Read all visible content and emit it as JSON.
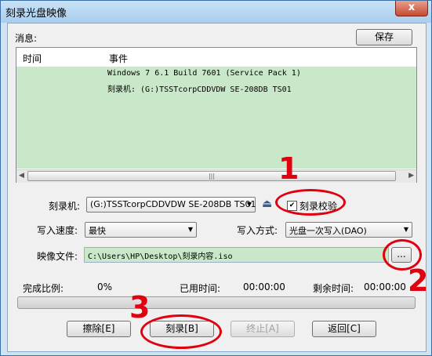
{
  "window": {
    "title": "刻录光盘映像",
    "close_label": "x"
  },
  "messages": {
    "label": "消息:",
    "save_label": "保存",
    "columns": [
      "时间",
      "事件"
    ],
    "rows": [
      "Windows 7 6.1 Build 7601 (Service Pack 1)",
      "刻录机:  (G:)TSSTcorpCDDVDW SE-208DB TS01"
    ]
  },
  "burner": {
    "label": "刻录机:",
    "value": "(G:)TSSTcorpCDDVDW SE-208DB TS01"
  },
  "verify": {
    "label": "刻录校验",
    "checked": true
  },
  "speed": {
    "label": "写入速度:",
    "value": "最快"
  },
  "mode": {
    "label": "写入方式:",
    "value": "光盘一次写入(DAO)"
  },
  "image_file": {
    "label": "映像文件:",
    "value": "C:\\Users\\HP\\Desktop\\刻录内容.iso",
    "browse_label": "..."
  },
  "status": {
    "percent_label": "完成比例:",
    "percent_value": "0%",
    "elapsed_label": "已用时间:",
    "elapsed_value": "00:00:00",
    "remaining_label": "剩余时间:",
    "remaining_value": "00:00:00",
    "progress_fraction": 0
  },
  "buttons": {
    "erase": "擦除[E]",
    "burn": "刻录[B]",
    "stop": "终止[A]",
    "close": "返回[C]"
  },
  "annotations": {
    "n1": "1",
    "n2": "2",
    "n3": "3"
  },
  "colors": {
    "annotation": "#e0000f",
    "log_bg": "#c9e8c9"
  }
}
